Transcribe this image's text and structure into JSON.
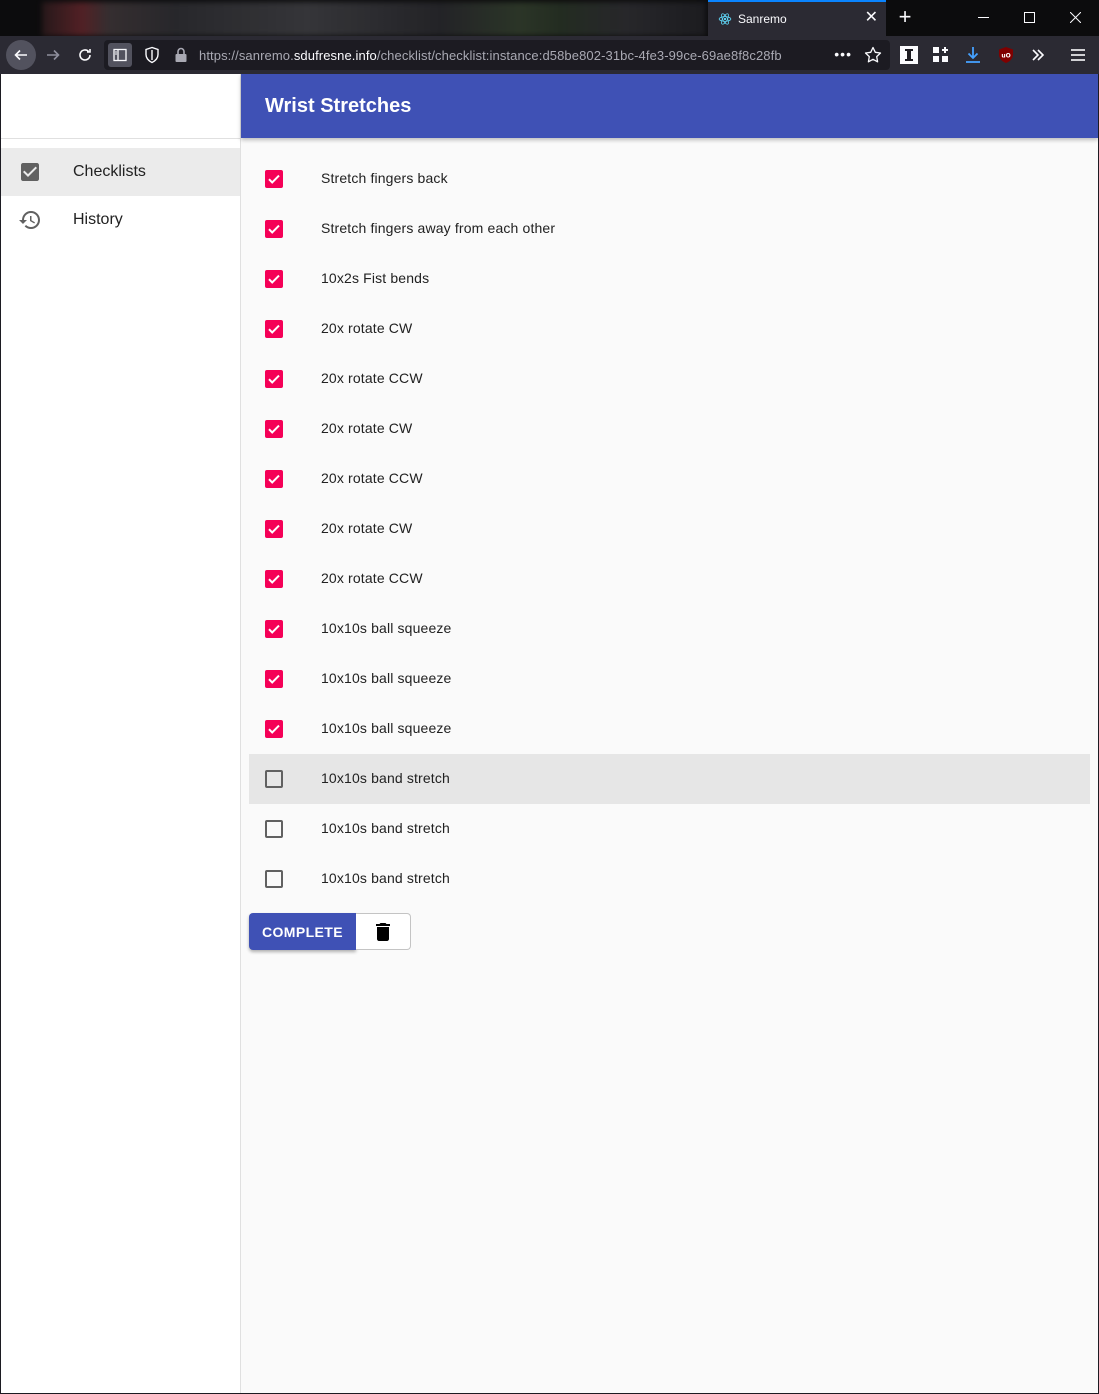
{
  "browser": {
    "tab_title": "Sanremo",
    "url_prefix": "https://sanremo.",
    "url_domain": "sdufresne.info",
    "url_path": "/checklist/checklist:instance:d58be802-31bc-4fe3-99ce-69ae8f8c28fb",
    "more_label": "•••",
    "new_tab_label": "+"
  },
  "sidebar": {
    "items": [
      {
        "label": "Checklists",
        "icon": "checkbox-icon",
        "active": true
      },
      {
        "label": "History",
        "icon": "history-icon",
        "active": false
      }
    ]
  },
  "header": {
    "title": "Wrist Stretches"
  },
  "checklist": {
    "items": [
      {
        "label": "Stretch fingers back",
        "checked": true
      },
      {
        "label": "Stretch fingers away from each other",
        "checked": true
      },
      {
        "label": "10x2s Fist bends",
        "checked": true
      },
      {
        "label": "20x rotate CW",
        "checked": true
      },
      {
        "label": "20x rotate CCW",
        "checked": true
      },
      {
        "label": "20x rotate CW",
        "checked": true
      },
      {
        "label": "20x rotate CCW",
        "checked": true
      },
      {
        "label": "20x rotate CW",
        "checked": true
      },
      {
        "label": "20x rotate CCW",
        "checked": true
      },
      {
        "label": "10x10s ball squeeze",
        "checked": true
      },
      {
        "label": "10x10s ball squeeze",
        "checked": true
      },
      {
        "label": "10x10s ball squeeze",
        "checked": true
      },
      {
        "label": "10x10s band stretch",
        "checked": false,
        "hovered": true
      },
      {
        "label": "10x10s band stretch",
        "checked": false
      },
      {
        "label": "10x10s band stretch",
        "checked": false
      }
    ]
  },
  "actions": {
    "complete_label": "COMPLETE",
    "delete_icon": "trash-icon"
  },
  "colors": {
    "primary": "#3f51b5",
    "accent": "#f50057"
  }
}
